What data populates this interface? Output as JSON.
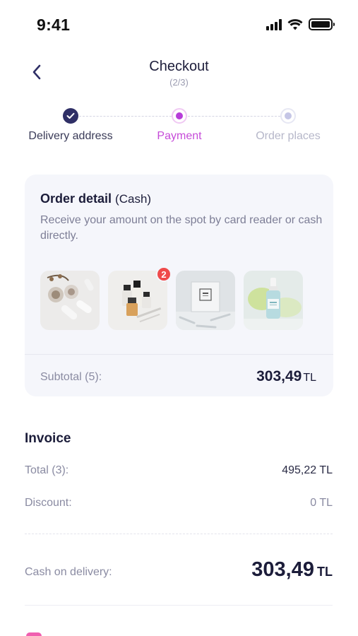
{
  "status_bar": {
    "time": "9:41",
    "icons": [
      "signal-icon",
      "wifi-icon",
      "battery-icon"
    ]
  },
  "header": {
    "title": "Checkout",
    "step": "(2/3)",
    "back_icon": "chevron-left-icon"
  },
  "stepper": {
    "steps": [
      {
        "label": "Delivery address",
        "state": "done"
      },
      {
        "label": "Payment",
        "state": "active"
      },
      {
        "label": "Order places",
        "state": "pending"
      }
    ]
  },
  "order_detail": {
    "title": "Order detail",
    "payment_mode": "(Cash)",
    "description": "Receive your amount on the spot by card reader or cash directly.",
    "products": [
      {
        "name": "accessories-product",
        "badge": ""
      },
      {
        "name": "perfume-set-product",
        "badge": "2"
      },
      {
        "name": "boxed-product",
        "badge": ""
      },
      {
        "name": "serum-bottle-product",
        "badge": ""
      }
    ],
    "subtotal_label": "Subtotal (5):",
    "subtotal_amount": "303,49",
    "subtotal_currency": "TL"
  },
  "invoice": {
    "title": "Invoice",
    "total_label": "Total (3):",
    "total_value": "495,22 TL",
    "discount_label": "Discount:",
    "discount_value": "0 TL",
    "cod_label": "Cash on delivery:",
    "cod_amount": "303,49",
    "cod_currency": "TL"
  },
  "colors": {
    "accent": "#c64bd9",
    "dark": "#1c1d3a",
    "muted": "#8a8ba2",
    "badge": "#ef4a4a"
  }
}
